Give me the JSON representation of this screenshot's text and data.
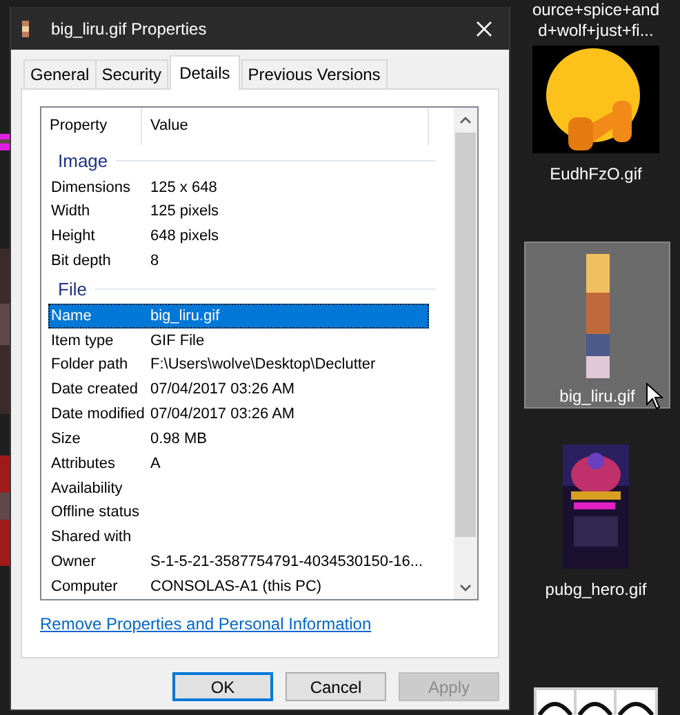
{
  "desktop": {
    "side_icons": [
      {
        "label_lines": [
          "ource+spice+and",
          "d+wolf+just+fi..."
        ],
        "kind": "text"
      },
      {
        "label_lines": [
          "EudhFzO.gif"
        ],
        "kind": "emoji",
        "selected": false
      },
      {
        "label_lines": [
          "big_liru.gif"
        ],
        "kind": "strip",
        "selected": true
      },
      {
        "label_lines": [
          "pubg_hero.gif"
        ],
        "kind": "poster",
        "selected": false
      },
      {
        "kind": "row"
      }
    ]
  },
  "dialog": {
    "title": "big_liru.gif Properties",
    "tabs": [
      {
        "label": "General",
        "selected": false
      },
      {
        "label": "Security",
        "selected": false
      },
      {
        "label": "Details",
        "selected": true
      },
      {
        "label": "Previous Versions",
        "selected": false
      }
    ],
    "columns": [
      "Property",
      "Value"
    ],
    "groups": [
      {
        "name": "Image",
        "rows": [
          {
            "property": "Dimensions",
            "value": "125 x 648",
            "selected": false
          },
          {
            "property": "Width",
            "value": "125 pixels",
            "selected": false
          },
          {
            "property": "Height",
            "value": "648 pixels",
            "selected": false
          },
          {
            "property": "Bit depth",
            "value": "8",
            "selected": false
          }
        ]
      },
      {
        "name": "File",
        "rows": [
          {
            "property": "Name",
            "value": "big_liru.gif",
            "selected": true
          },
          {
            "property": "Item type",
            "value": "GIF File",
            "selected": false
          },
          {
            "property": "Folder path",
            "value": "F:\\Users\\wolve\\Desktop\\Declutter",
            "selected": false
          },
          {
            "property": "Date created",
            "value": "07/04/2017 03:26 AM",
            "selected": false
          },
          {
            "property": "Date modified",
            "value": "07/04/2017 03:26 AM",
            "selected": false
          },
          {
            "property": "Size",
            "value": "0.98 MB",
            "selected": false
          },
          {
            "property": "Attributes",
            "value": "A",
            "selected": false
          },
          {
            "property": "Availability",
            "selected": false
          },
          {
            "property": "Offline status",
            "selected": false
          },
          {
            "property": "Shared with",
            "selected": false
          },
          {
            "property": "Owner",
            "value": "S-1-5-21-3587754791-4034530150-16...",
            "selected": false
          },
          {
            "property": "Computer",
            "value": "CONSOLAS-A1 (this PC)",
            "selected": false
          }
        ]
      }
    ],
    "link": "Remove Properties and Personal Information",
    "buttons": [
      {
        "label": "OK",
        "default": true,
        "disabled": false
      },
      {
        "label": "Cancel",
        "default": false,
        "disabled": false
      },
      {
        "label": "Apply",
        "default": false,
        "disabled": true
      }
    ]
  }
}
